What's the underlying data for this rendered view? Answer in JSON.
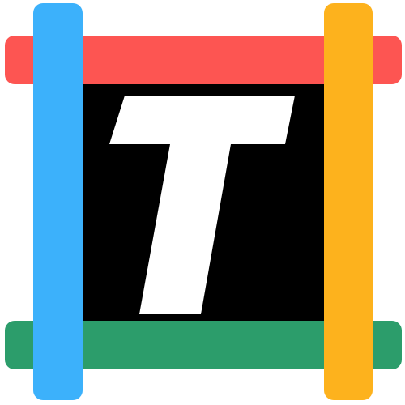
{
  "logo": {
    "letter": "T",
    "colors": {
      "top_bar": "#fd5552",
      "bottom_bar": "#2c9d6b",
      "left_bar": "#3cb1fb",
      "right_bar": "#fdb21d",
      "center_background": "#000000",
      "letter_color": "#ffffff"
    }
  }
}
